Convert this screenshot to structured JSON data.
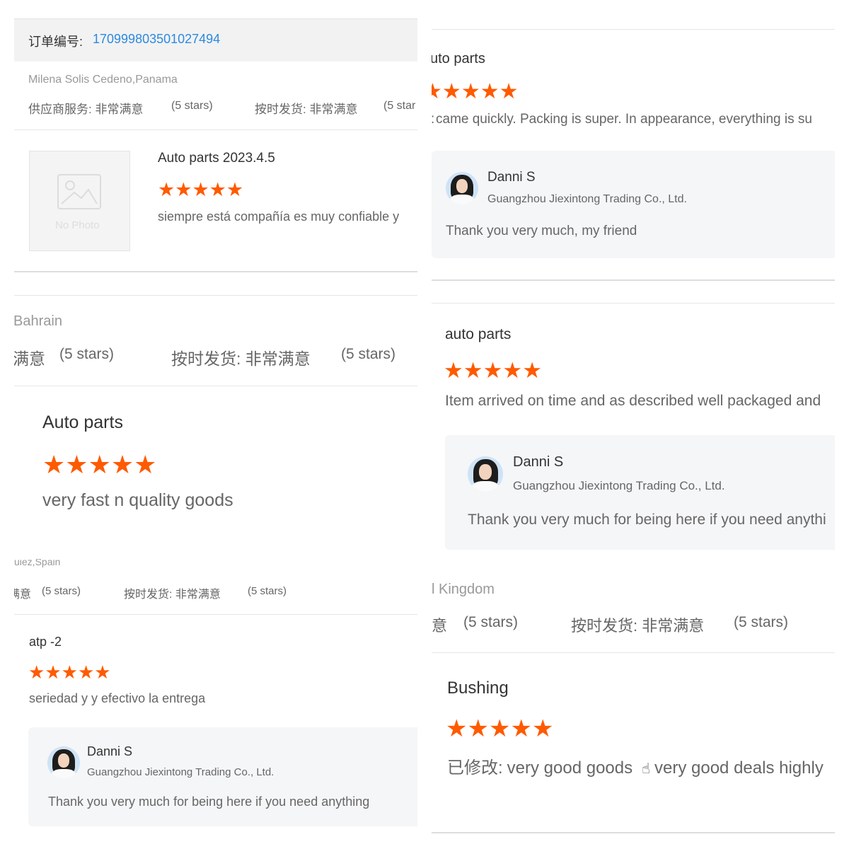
{
  "brand": {
    "star_color": "#ff5a00",
    "link_color": "#2c8ae0"
  },
  "p1": {
    "order_label": "订单编号:",
    "order_number": "170999803501027494",
    "buyer": "Milena Solis Cedeno,Panama",
    "rating_supplier": "供应商服务: 非常满意",
    "rating_supplier_stars": "(5 stars)",
    "rating_shipping": "按时发货: 非常满意",
    "rating_shipping_stars": "(5 star",
    "no_photo": "No Photo",
    "product": "Auto parts 2023.4.5",
    "stars": 5,
    "review": "siempre está compañía es muy confiable y"
  },
  "p2": {
    "title": "uto parts",
    "stars": 5,
    "review": "came quickly. Packing is super. In appearance, everything is su",
    "reply_name": "Danni S",
    "reply_company": "Guangzhou Jiexintong Trading Co., Ltd.",
    "reply_text": "Thank you very much, my friend"
  },
  "p3": {
    "buyer": "Bahrain",
    "rating_supplier": "满意",
    "rating_supplier_stars": "(5 stars)",
    "rating_shipping": "按时发货: 非常满意",
    "rating_shipping_stars": "(5 stars)",
    "product": "Auto parts",
    "stars": 5,
    "review": "very fast n quality goods"
  },
  "p4": {
    "title": "auto parts",
    "stars": 5,
    "review": "Item arrived on time and as described well packaged and",
    "reply_name": "Danni S",
    "reply_company": "Guangzhou Jiexintong Trading Co., Ltd.",
    "reply_text": "Thank you very much for being here if you need anythi"
  },
  "p5": {
    "buyer": "uiez,Spain",
    "rating_supplier": "满意",
    "rating_supplier_stars": "(5 stars)",
    "rating_shipping": "按时发货: 非常满意",
    "rating_shipping_stars": "(5 stars)",
    "product": "atp -2",
    "stars": 5,
    "review": "seriedad y y efectivo la entrega",
    "reply_name": "Danni S",
    "reply_company": "Guangzhou Jiexintong Trading Co., Ltd.",
    "reply_text": "Thank you very much for being here if you need anything"
  },
  "p6": {
    "buyer": "l Kingdom",
    "rating_supplier": "意",
    "rating_supplier_stars": "(5 stars)",
    "rating_shipping": "按时发货: 非常满意",
    "rating_shipping_stars": "(5 stars)",
    "product": "Bushing",
    "stars": 5,
    "review_prefix": "已修改:",
    "review": "very good goods",
    "review_suffix": "very good deals highly"
  }
}
